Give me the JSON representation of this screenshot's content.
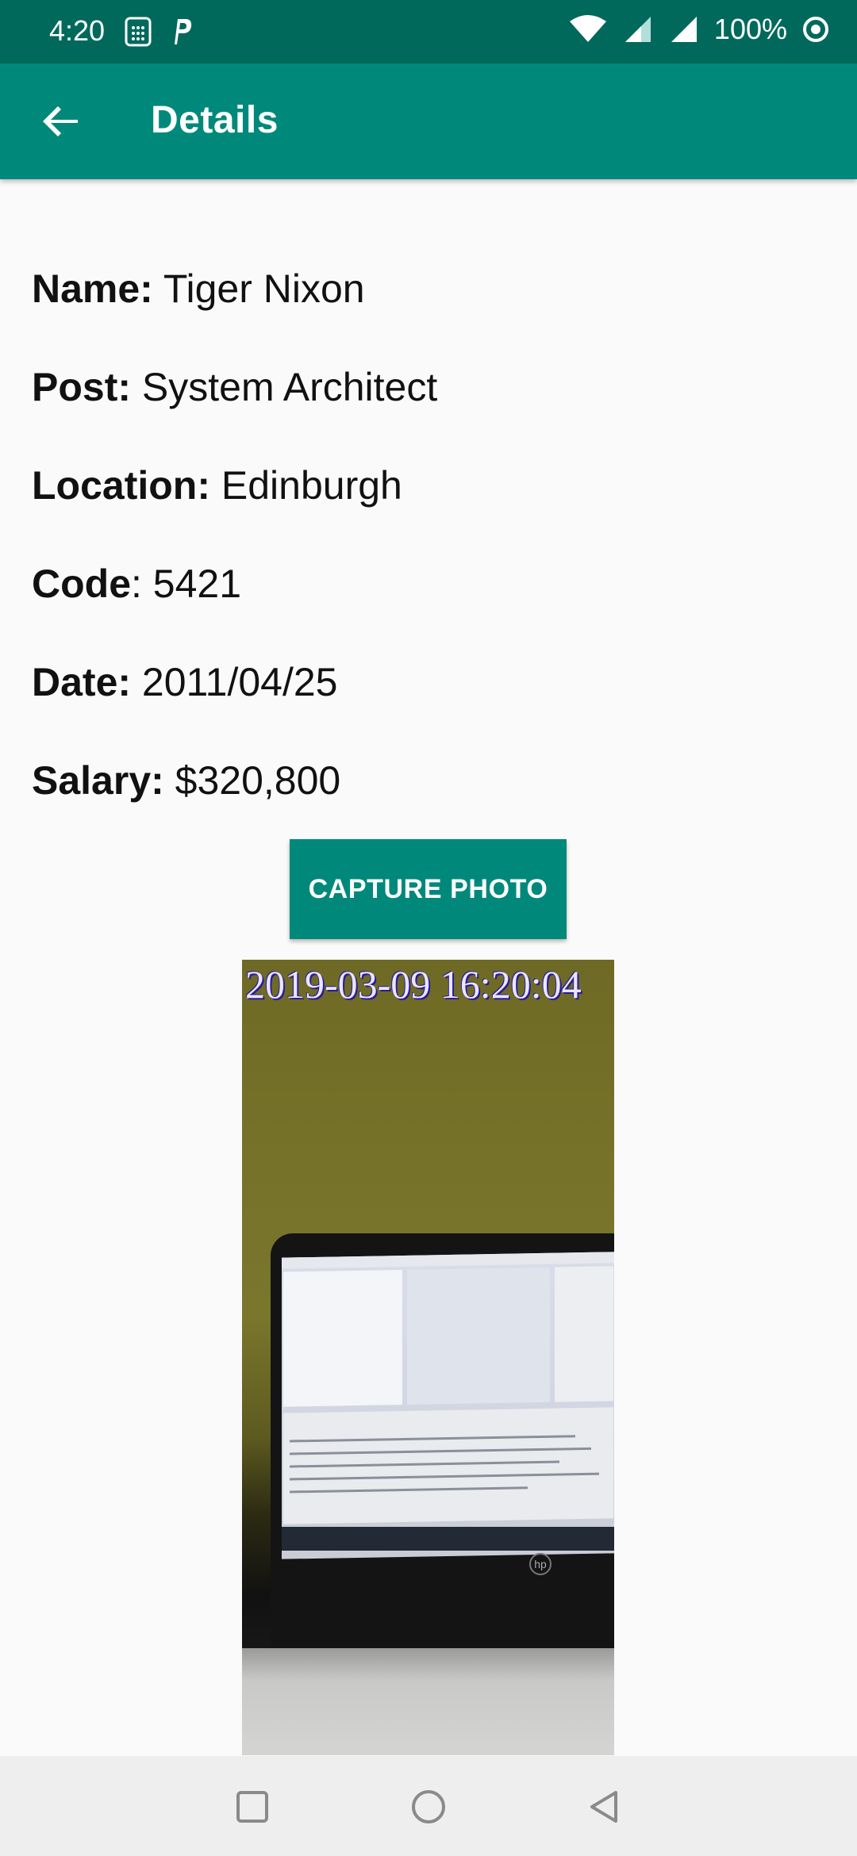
{
  "status_bar": {
    "time": "4:20",
    "battery": "100%",
    "icons": [
      "sim-card-icon",
      "parking-icon",
      "wifi-icon",
      "signal-icon",
      "signal-icon",
      "data-saver-icon"
    ]
  },
  "app_bar": {
    "title": "Details",
    "back_icon": "arrow-left-icon"
  },
  "details": [
    {
      "label": "Name:",
      "value": " Tiger Nixon"
    },
    {
      "label": "Post:",
      "value": " System Architect"
    },
    {
      "label": "Location:",
      "value": " Edinburgh"
    },
    {
      "label": "Code",
      "value": ": 5421"
    },
    {
      "label": "Date:",
      "value": " 2011/04/25"
    },
    {
      "label": "Salary:",
      "value": " $320,800"
    }
  ],
  "capture_button": {
    "label": "CAPTURE PHOTO"
  },
  "photo": {
    "timestamp": "2019-03-09 16:20:04"
  },
  "nav_bar": {
    "icons": [
      "recents-square-icon",
      "home-circle-icon",
      "back-triangle-icon"
    ]
  },
  "colors": {
    "primary": "#00897b",
    "primary_dark": "#00695c",
    "background": "#fafafa"
  }
}
